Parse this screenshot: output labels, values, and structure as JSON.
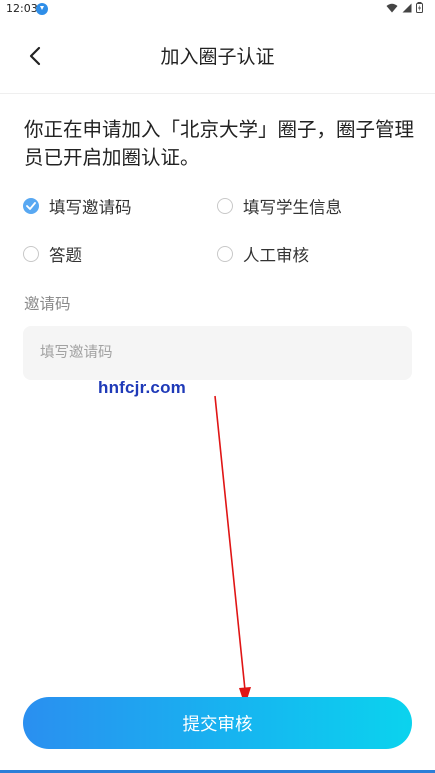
{
  "status_bar": {
    "time": "12:03"
  },
  "header": {
    "title": "加入圈子认证",
    "back_icon": "chevron-left-icon"
  },
  "intro": {
    "text": "你正在申请加入「北京大学」圈子，圈子管理员已开启加圈认证。"
  },
  "options": [
    {
      "label": "填写邀请码",
      "checked": true
    },
    {
      "label": "填写学生信息",
      "checked": false
    },
    {
      "label": "答题",
      "checked": false
    },
    {
      "label": "人工审核",
      "checked": false
    }
  ],
  "invite": {
    "label": "邀请码",
    "placeholder": "填写邀请码",
    "value": ""
  },
  "watermark": "hnfcjr.com",
  "submit": {
    "label": "提交审核"
  },
  "colors": {
    "accent": "#58a8f2",
    "button_start": "#2a8ff0",
    "button_end": "#0bd3ee",
    "annotation": "#e01515"
  }
}
